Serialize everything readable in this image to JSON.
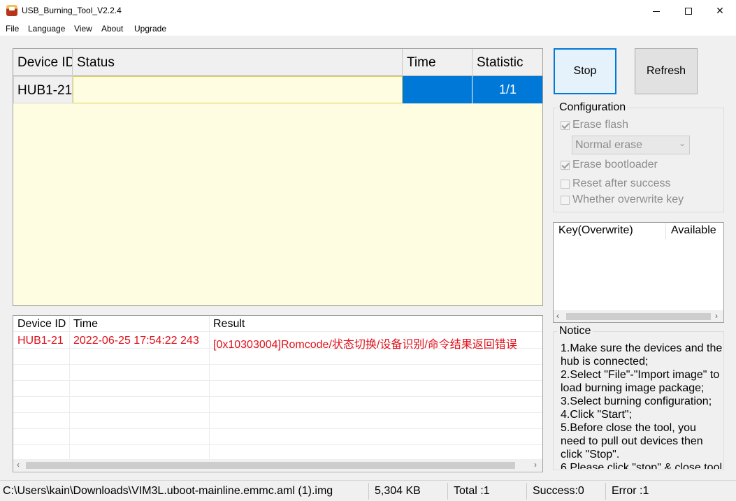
{
  "window": {
    "title": "USB_Burning_Tool_V2.2.4"
  },
  "menu": [
    "File",
    "Language",
    "View",
    "About",
    "Upgrade"
  ],
  "device_table": {
    "headers": [
      "Device ID",
      "Status",
      "Time",
      "Statistic"
    ],
    "rows": [
      {
        "device_id": "HUB1-21",
        "status": "",
        "time": "",
        "statistic": "1/1"
      }
    ]
  },
  "buttons": {
    "stop": "Stop",
    "refresh": "Refresh"
  },
  "configuration": {
    "title": "Configuration",
    "erase_flash": {
      "label": "Erase flash",
      "checked": true
    },
    "erase_mode": "Normal erase",
    "erase_bootloader": {
      "label": "Erase bootloader",
      "checked": true
    },
    "reset_after_success": {
      "label": "Reset after success",
      "checked": false
    },
    "overwrite_key": {
      "label": "Whether overwrite key",
      "checked": false
    }
  },
  "key_list": {
    "headers": [
      "Key(Overwrite)",
      "Available"
    ]
  },
  "notice": {
    "title": "Notice",
    "lines": [
      "1.Make sure the devices and the hub is connected;",
      "2.Select \"File\"-\"Import image\" to load burning image package;",
      "3.Select burning configuration;",
      "4.Click \"Start\";",
      "5.Before close the tool, you need to pull out devices then click \"Stop\".",
      "6.Please click \"stop\" & close tool"
    ]
  },
  "log_table": {
    "headers": [
      "Device ID",
      "Time",
      "Result"
    ],
    "rows": [
      {
        "device_id": "HUB1-21",
        "time": "2022-06-25 17:54:22 243",
        "result": "[0x10303004]Romcode/状态切换/设备识别/命令结果返回错误"
      }
    ]
  },
  "status_bar": {
    "path": "C:\\Users\\kain\\Downloads\\VIM3L.uboot-mainline.emmc.aml (1).img",
    "size": "5,304 KB",
    "total": "Total :1",
    "success": "Success:0",
    "error": "Error :1"
  },
  "colors": {
    "selection": "#0078d7",
    "error_text": "#e0101a",
    "status_bg": "#fffde1"
  }
}
